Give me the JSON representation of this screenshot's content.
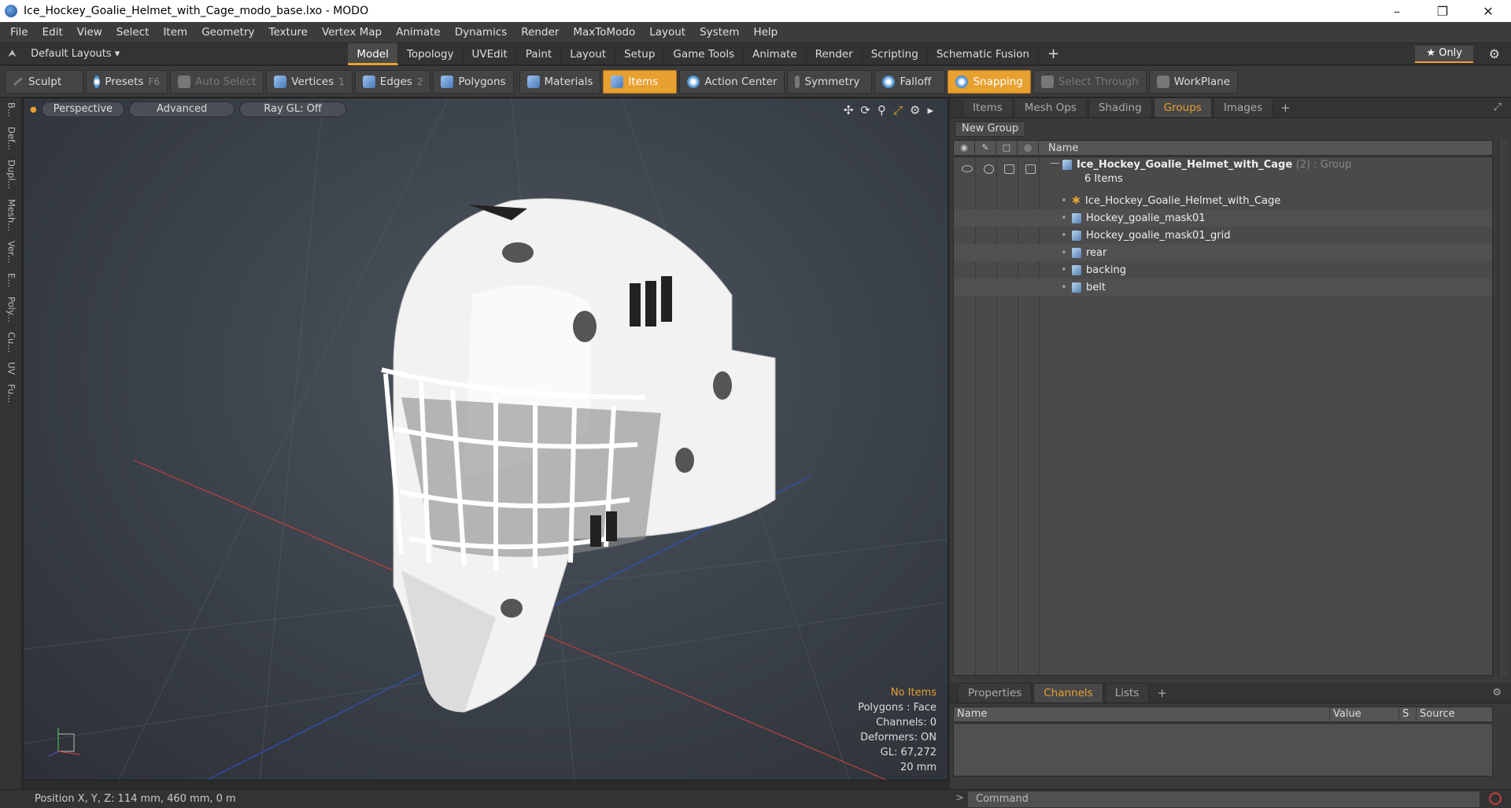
{
  "window": {
    "title": "Ice_Hockey_Goalie_Helmet_with_Cage_modo_base.lxo - MODO"
  },
  "menu": [
    "File",
    "Edit",
    "View",
    "Select",
    "Item",
    "Geometry",
    "Texture",
    "Vertex Map",
    "Animate",
    "Dynamics",
    "Render",
    "MaxToModo",
    "Layout",
    "System",
    "Help"
  ],
  "layout": {
    "label": "Default Layouts ▾"
  },
  "tabs": [
    "Model",
    "Topology",
    "UVEdit",
    "Paint",
    "Layout",
    "Setup",
    "Game Tools",
    "Animate",
    "Render",
    "Scripting",
    "Schematic Fusion"
  ],
  "only": "★ Only",
  "toolbar": {
    "sculpt": "Sculpt",
    "presets": "Presets",
    "presets_key": "F6",
    "autoselect": "Auto Select",
    "vertices": "Vertices",
    "vertices_n": "1",
    "edges": "Edges",
    "edges_n": "2",
    "polygons": "Polygons",
    "materials": "Materials",
    "items": "Items",
    "action_center": "Action Center",
    "symmetry": "Symmetry",
    "falloff": "Falloff",
    "snapping": "Snapping",
    "select_through": "Select Through",
    "workplane": "WorkPlane"
  },
  "left_strip": [
    "B...",
    "Def...",
    "Dupl...",
    "Mesh...",
    "Ver...",
    "E...",
    "Poly...",
    "Cu...",
    "UV",
    "Fu..."
  ],
  "viewport": {
    "perspective": "Perspective",
    "advanced": "Advanced",
    "raygl": "Ray GL: Off",
    "hud": {
      "items": "No Items",
      "polygons": "Polygons : Face",
      "channels": "Channels: 0",
      "deformers": "Deformers: ON",
      "gl": "GL: 67,272",
      "scale": "20 mm"
    }
  },
  "status": {
    "position": "Position X, Y, Z:   114 mm, 460 mm, 0 m",
    "command": "Command"
  },
  "panel": {
    "tabs": [
      "Items",
      "Mesh Ops",
      "Shading",
      "Groups",
      "Images"
    ],
    "new_group": "New Group",
    "name_col": "Name",
    "group": {
      "name": "Ice_Hockey_Goalie_Helmet_with_Cage",
      "meta": "(2) : Group",
      "count": "6 Items"
    },
    "items": [
      "Ice_Hockey_Goalie_Helmet_with_Cage",
      "Hockey_goalie_mask01",
      "Hockey_goalie_mask01_grid",
      "rear",
      "backing",
      "belt"
    ],
    "lower_tabs": [
      "Properties",
      "Channels",
      "Lists"
    ],
    "columns": [
      "Name",
      "Value",
      "S",
      "Source"
    ]
  },
  "colors": {
    "accent": "#e8a030"
  }
}
